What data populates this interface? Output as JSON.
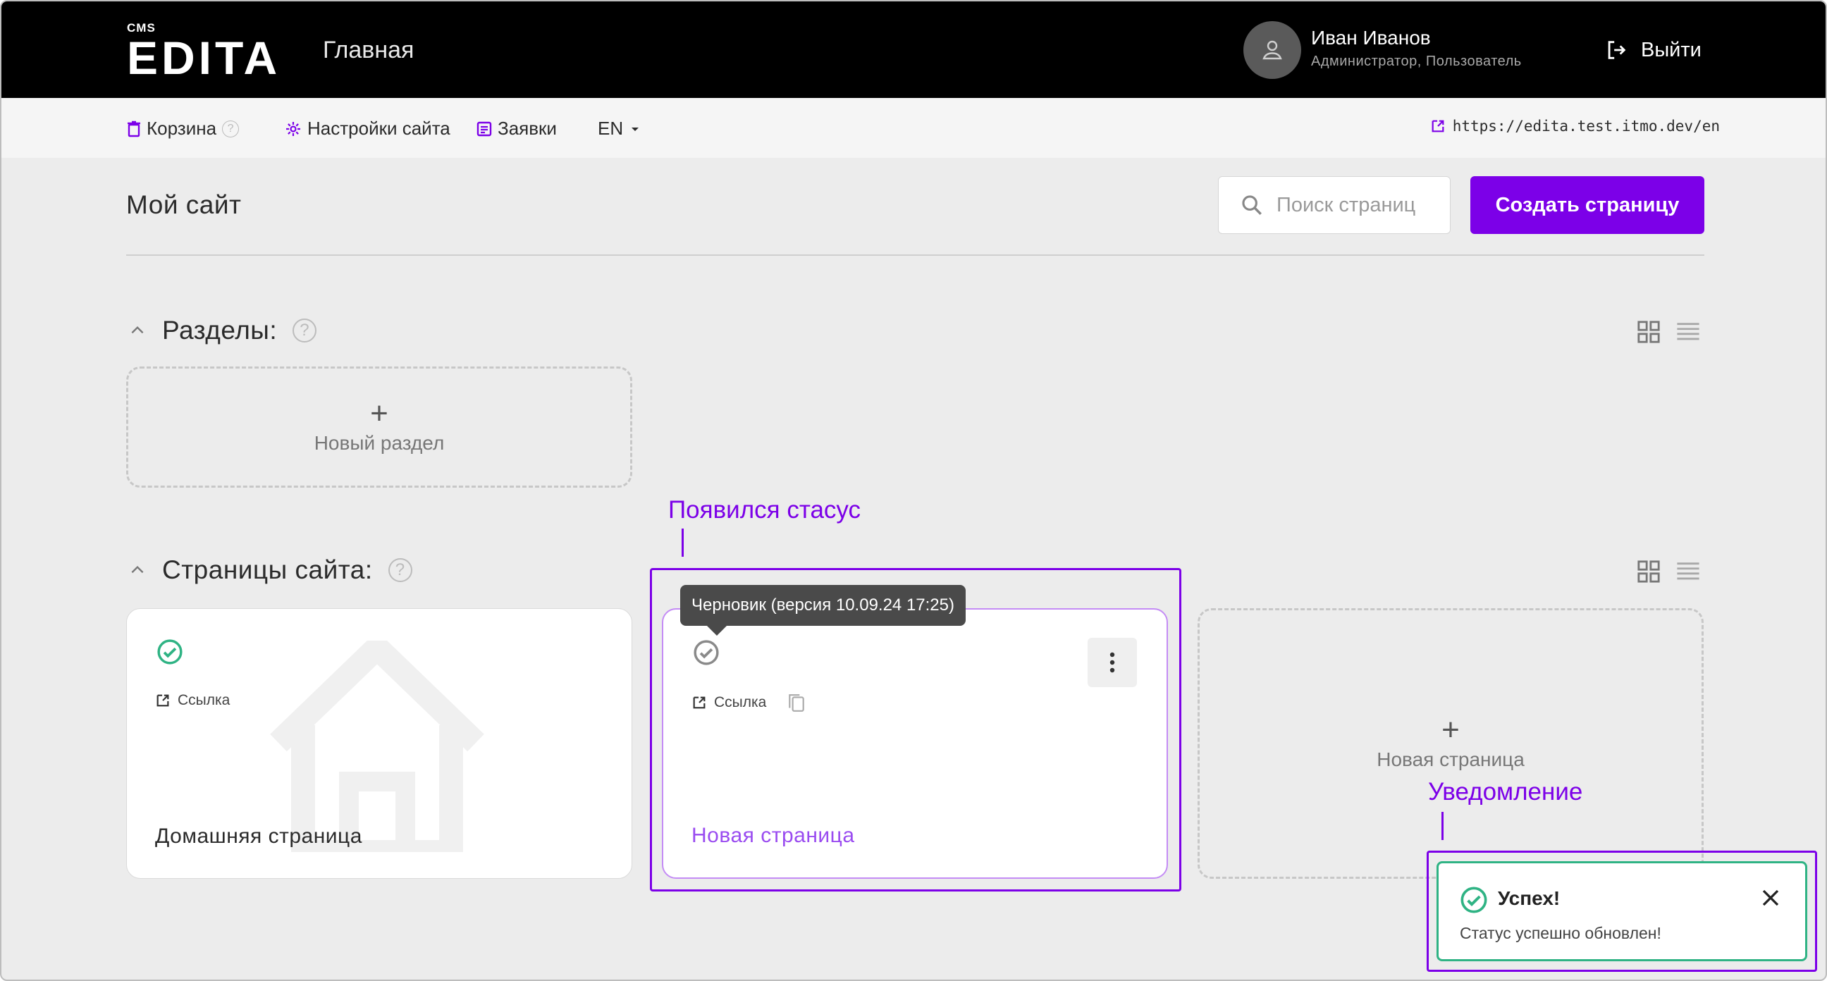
{
  "header": {
    "logo_small": "CMS",
    "logo_main": "EDITA",
    "title": "Главная",
    "user_name": "Иван Иванов",
    "user_role": "Администратор, Пользователь",
    "logout_label": "Выйти"
  },
  "toolbar": {
    "trash_label": "Корзина",
    "settings_label": "Настройки сайта",
    "requests_label": "Заявки",
    "language": "EN",
    "site_url": "https://edita.test.itmo.dev/en"
  },
  "main": {
    "heading": "Мой сайт",
    "search_placeholder": "Поиск страниц",
    "create_button": "Создать страницу",
    "sections_title": "Разделы:",
    "new_section_label": "Новый раздел",
    "pages_title": "Страницы сайта:",
    "new_page_label": "Новая страница"
  },
  "cards": [
    {
      "title": "Домашняя страница",
      "link_label": "Ссылка",
      "status": "published"
    },
    {
      "title": "Новая страница",
      "link_label": "Ссылка",
      "status": "draft",
      "tooltip": "Черновик (версия 10.09.24 17:25)"
    }
  ],
  "annotations": {
    "status_note": "Появился стасус",
    "toast_note": "Уведомление"
  },
  "toast": {
    "title": "Успех!",
    "message": "Статус успешно обновлен!"
  },
  "colors": {
    "accent": "#7c00e8",
    "success": "#2fb384",
    "header_bg": "#000000"
  }
}
